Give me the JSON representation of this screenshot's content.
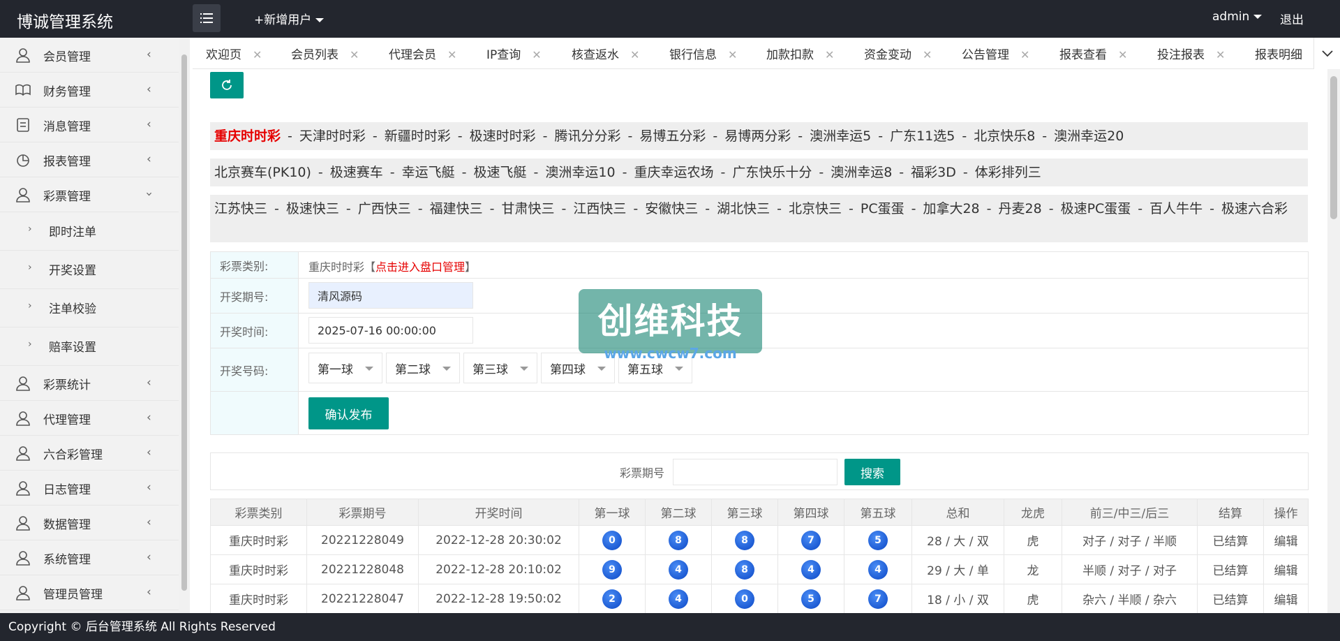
{
  "app": {
    "title": "博诚管理系统",
    "add_user": "+新增用户",
    "admin": "admin",
    "logout": "退出"
  },
  "sidebar": {
    "items": [
      {
        "label": "会员管理",
        "icon": "user-icon"
      },
      {
        "label": "财务管理",
        "icon": "book-icon"
      },
      {
        "label": "消息管理",
        "icon": "message-icon"
      },
      {
        "label": "报表管理",
        "icon": "report-icon"
      },
      {
        "label": "彩票管理",
        "icon": "user-icon"
      }
    ],
    "sub_items": [
      {
        "label": "即时注单"
      },
      {
        "label": "开奖设置"
      },
      {
        "label": "注单校验"
      },
      {
        "label": "赔率设置"
      }
    ],
    "items_after": [
      {
        "label": "彩票统计"
      },
      {
        "label": "代理管理"
      },
      {
        "label": "六合彩管理"
      },
      {
        "label": "日志管理"
      },
      {
        "label": "数据管理"
      },
      {
        "label": "系统管理"
      },
      {
        "label": "管理员管理"
      }
    ]
  },
  "tabs": [
    "欢迎页",
    "会员列表",
    "代理会员",
    "IP查询",
    "核查返水",
    "银行信息",
    "加款扣款",
    "资金变动",
    "公告管理",
    "报表查看",
    "投注报表",
    "报表明细"
  ],
  "lottery_rows": [
    [
      "重庆时时彩",
      "天津时时彩",
      "新疆时时彩",
      "极速时时彩",
      "腾讯分分彩",
      "易博五分彩",
      "易博两分彩",
      "澳洲幸运5",
      "广东11选5",
      "北京快乐8",
      "澳洲幸运20"
    ],
    [
      "北京赛车(PK10)",
      "极速赛车",
      "幸运飞艇",
      "极速飞艇",
      "澳洲幸运10",
      "重庆幸运农场",
      "广东快乐十分",
      "澳洲幸运8",
      "福彩3D",
      "体彩排列三"
    ],
    [
      "江苏快三",
      "极速快三",
      "广西快三",
      "福建快三",
      "甘肃快三",
      "江西快三",
      "安徽快三",
      "湖北快三",
      "北京快三",
      "PC蛋蛋",
      "加拿大28",
      "丹麦28",
      "极速PC蛋蛋",
      "百人牛牛",
      "极速六合彩"
    ]
  ],
  "form": {
    "type_label": "彩票类别:",
    "type_value": "重庆时时彩",
    "type_link": "点击进入盘口管理",
    "period_label": "开奖期号:",
    "period_value": "清风源码",
    "time_label": "开奖时间:",
    "time_value": "2025-07-16 00:00:00",
    "number_label": "开奖号码:",
    "balls": [
      "第一球",
      "第二球",
      "第三球",
      "第四球",
      "第五球"
    ],
    "publish": "确认发布"
  },
  "watermark": {
    "text": "创维科技",
    "url": "www.cwcw7.com"
  },
  "search": {
    "label": "彩票期号",
    "button": "搜索"
  },
  "table": {
    "headers": [
      "彩票类别",
      "彩票期号",
      "开奖时间",
      "第一球",
      "第二球",
      "第三球",
      "第四球",
      "第五球",
      "总和",
      "龙虎",
      "前三/中三/后三",
      "结算",
      "操作"
    ],
    "rows": [
      {
        "type": "重庆时时彩",
        "period": "20221228049",
        "time": "2022-12-28 20:30:02",
        "balls": [
          "0",
          "8",
          "8",
          "7",
          "5"
        ],
        "sum": "28 / 大 / 双",
        "lh": "虎",
        "pos": "对子 / 对子 / 半顺",
        "status": "已结算",
        "op": "编辑"
      },
      {
        "type": "重庆时时彩",
        "period": "20221228048",
        "time": "2022-12-28 20:10:02",
        "balls": [
          "9",
          "4",
          "8",
          "4",
          "4"
        ],
        "sum": "29 / 大 / 单",
        "lh": "龙",
        "pos": "半顺 / 对子 / 对子",
        "status": "已结算",
        "op": "编辑"
      },
      {
        "type": "重庆时时彩",
        "period": "20221228047",
        "time": "2022-12-28 19:50:02",
        "balls": [
          "2",
          "4",
          "0",
          "5",
          "7"
        ],
        "sum": "18 / 小 / 双",
        "lh": "虎",
        "pos": "杂六 / 半顺 / 杂六",
        "status": "已结算",
        "op": "编辑"
      }
    ]
  },
  "footer": "Copyright © 后台管理系统 All Rights Reserved",
  "colors": {
    "accent": "#009688",
    "topbar": "#23262e",
    "active": "#e60000"
  }
}
